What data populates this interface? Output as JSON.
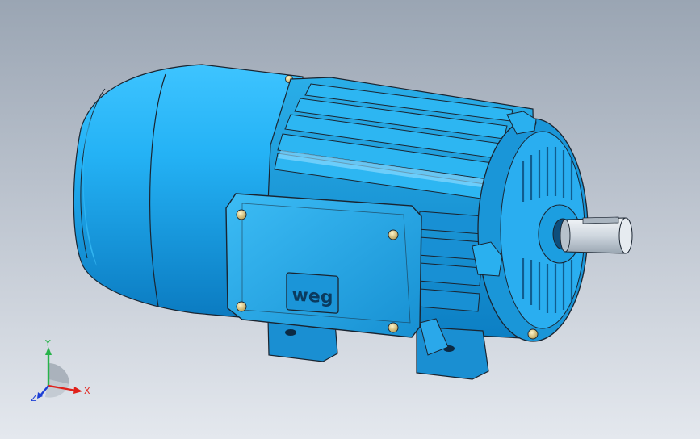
{
  "viewport": {
    "background_top": "#9aa5b3",
    "background_bottom": "#e4e8ee"
  },
  "model": {
    "part": "electric-motor",
    "body_color": "#1ea5e6",
    "body_highlight": "#5fd0ff",
    "body_shadow": "#0a6fa8",
    "edge_color": "#1a2430",
    "bolt_color": "#d8c27a",
    "shaft_color": "#d6dde4",
    "logo": "weg"
  },
  "triad": {
    "x_label": "X",
    "y_label": "Y",
    "z_label": "Z",
    "x_color": "#e0221b",
    "y_color": "#27b34a",
    "z_color": "#1c3fd6"
  }
}
